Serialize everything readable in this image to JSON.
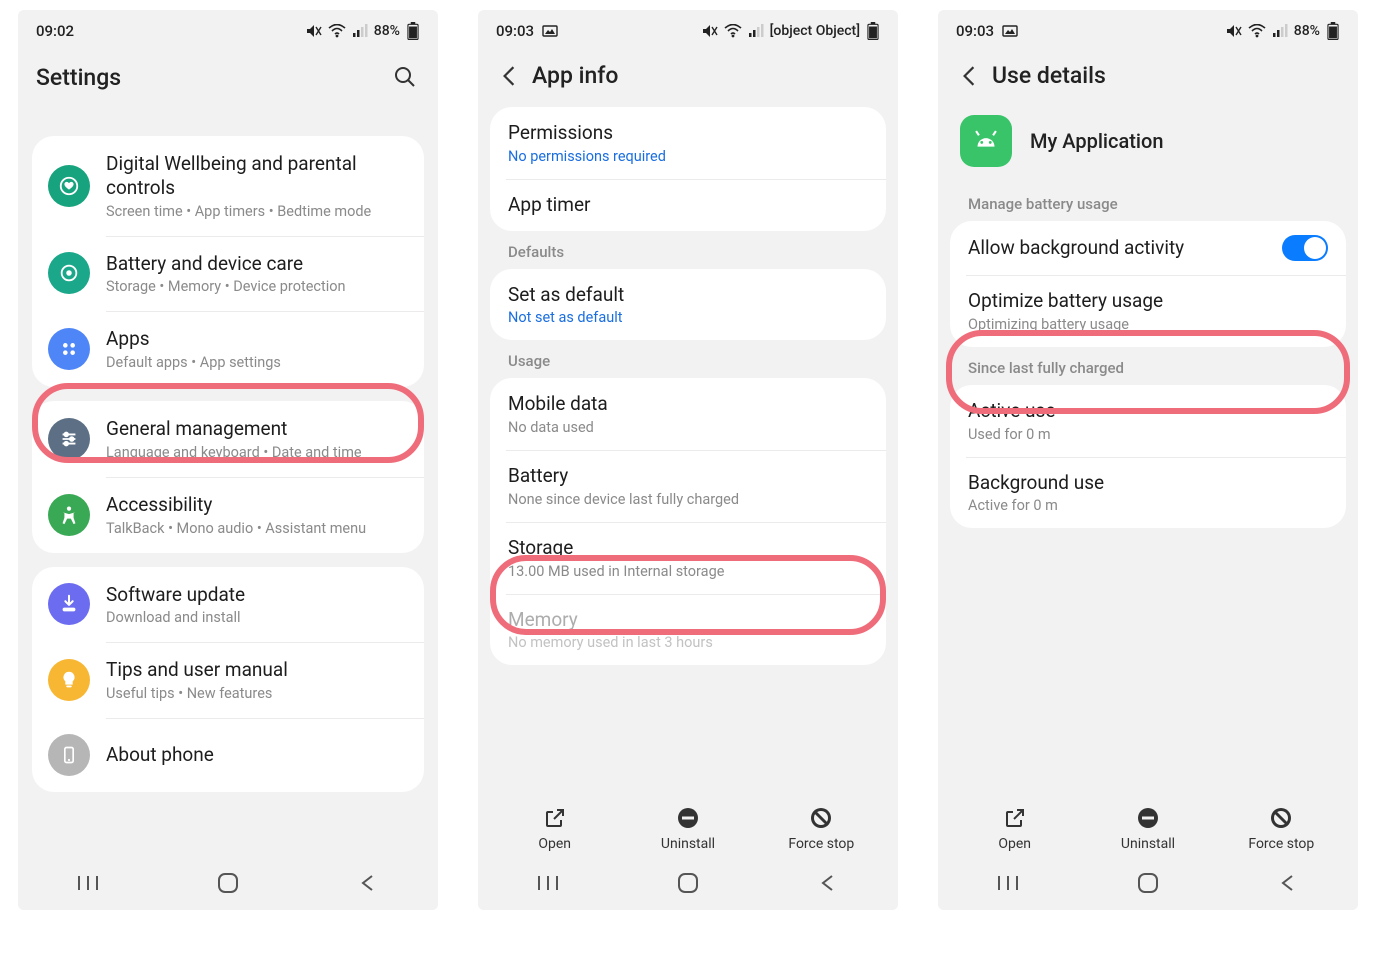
{
  "s1": {
    "time": "09:02",
    "battery": "88%",
    "title": "Settings",
    "items": [
      {
        "title": "Digital Wellbeing and parental controls",
        "sub": "Screen time  •  App timers  •  Bedtime mode",
        "color": "#16a37d",
        "icon": "heart"
      },
      {
        "title": "Battery and device care",
        "sub": "Storage  •  Memory  •  Device protection",
        "color": "#1aa78a",
        "icon": "care"
      },
      {
        "title": "Apps",
        "sub": "Default apps  •  App settings",
        "color": "#4f86f7",
        "icon": "apps"
      },
      {
        "title": "General management",
        "sub": "Language and keyboard  •  Date and time",
        "color": "#5c6f85",
        "icon": "sliders"
      },
      {
        "title": "Accessibility",
        "sub": "TalkBack  •  Mono audio  •  Assistant menu",
        "color": "#3aa956",
        "icon": "a11y"
      },
      {
        "title": "Software update",
        "sub": "Download and install",
        "color": "#6c6cf0",
        "icon": "update"
      },
      {
        "title": "Tips and user manual",
        "sub": "Useful tips  •  New features",
        "color": "#f7b733",
        "icon": "bulb"
      },
      {
        "title": "About phone",
        "sub": "",
        "color": "#b6b6b6",
        "icon": "phone"
      }
    ]
  },
  "s2": {
    "time": "09:03",
    "battery": {
      "title": "Battery",
      "sub": "None since device last fully charged"
    },
    "title": "App info",
    "perm": {
      "title": "Permissions",
      "sub": "No permissions required"
    },
    "apptimer": "App timer",
    "defaults_hd": "Defaults",
    "setdef": {
      "title": "Set as default",
      "sub": "Not set as default"
    },
    "usage_hd": "Usage",
    "mobile": {
      "title": "Mobile data",
      "sub": "No data used"
    },
    "storage": {
      "title": "Storage",
      "sub": "13.00 MB used in Internal storage"
    },
    "memory": {
      "title": "Memory",
      "sub": "No memory used in last 3 hours"
    },
    "actions": {
      "open": "Open",
      "uninstall": "Uninstall",
      "force": "Force stop"
    }
  },
  "s3": {
    "time": "09:03",
    "battery_pct": "88%",
    "title": "Use details",
    "appname": "My Application",
    "manage_hd": "Manage battery usage",
    "allowbg": "Allow background activity",
    "optimize": {
      "title": "Optimize battery usage",
      "sub": "Optimizing battery usage"
    },
    "since_hd": "Since last fully charged",
    "active": {
      "title": "Active use",
      "sub": "Used for 0 m"
    },
    "bg": {
      "title": "Background use",
      "sub": "Active for 0 m"
    },
    "actions": {
      "open": "Open",
      "uninstall": "Uninstall",
      "force": "Force stop"
    }
  }
}
